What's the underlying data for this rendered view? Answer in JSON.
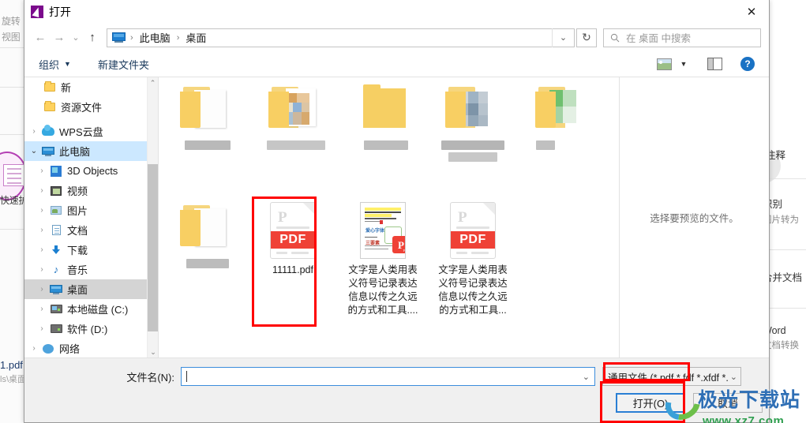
{
  "background_app": {
    "left_labels": [
      "旋转",
      "视图"
    ],
    "left_bottom_file": "1.pdf",
    "left_bottom_path": "ls\\桌面",
    "left_tool_label": "快速护",
    "right_items": [
      {
        "title": "注释",
        "sub": ""
      },
      {
        "title": "识别",
        "sub": "图片转为"
      },
      {
        "title": "合并文档",
        "sub": ""
      },
      {
        "title": "Word",
        "sub": "文档转换"
      }
    ]
  },
  "dialog": {
    "title": "打开",
    "title_icon": "pdf-app-icon",
    "close_label": "✕"
  },
  "address_bar": {
    "back_icon": "back-arrow-icon",
    "forward_icon": "forward-arrow-icon",
    "recent_icon": "chevron-down-icon",
    "up_icon": "up-arrow-icon",
    "root_icon": "this-pc-icon",
    "breadcrumbs": [
      "此电脑",
      "桌面"
    ],
    "separator": "›",
    "dropdown_icon": "chevron-down-icon",
    "refresh_icon": "refresh-icon",
    "refresh_label": "↻"
  },
  "search": {
    "icon": "search-icon",
    "placeholder": "在 桌面 中搜索"
  },
  "toolbar": {
    "organize_label": "组织",
    "organize_caret": "▼",
    "new_folder_label": "新建文件夹",
    "view_icon": "view-mode-icon",
    "view_caret": "▼",
    "preview_pane_icon": "preview-pane-icon",
    "help_icon": "help-icon",
    "help_label": "?"
  },
  "sidebar": {
    "items": [
      {
        "label": "新",
        "icon": "folder-icon",
        "chevron": "",
        "state": "none",
        "indent": 1
      },
      {
        "label": "资源文件",
        "icon": "folder-icon",
        "chevron": "",
        "state": "none",
        "indent": 1
      },
      {
        "label": "WPS云盘",
        "icon": "cloud-icon",
        "chevron": "›",
        "state": "none",
        "indent": 0
      },
      {
        "label": "此电脑",
        "icon": "this-pc-icon",
        "chevron": "⌄",
        "state": "selected-blue",
        "indent": 0
      },
      {
        "label": "3D Objects",
        "icon": "3d-objects-icon",
        "chevron": "›",
        "state": "none",
        "indent": 1
      },
      {
        "label": "视频",
        "icon": "videos-icon",
        "chevron": "›",
        "state": "none",
        "indent": 1
      },
      {
        "label": "图片",
        "icon": "pictures-icon",
        "chevron": "›",
        "state": "none",
        "indent": 1
      },
      {
        "label": "文档",
        "icon": "documents-icon",
        "chevron": "›",
        "state": "none",
        "indent": 1
      },
      {
        "label": "下载",
        "icon": "downloads-icon",
        "chevron": "›",
        "state": "none",
        "indent": 1
      },
      {
        "label": "音乐",
        "icon": "music-icon",
        "chevron": "›",
        "state": "none",
        "indent": 1
      },
      {
        "label": "桌面",
        "icon": "desktop-icon",
        "chevron": "›",
        "state": "selected-grey",
        "indent": 1
      },
      {
        "label": "本地磁盘 (C:)",
        "icon": "drive-icon",
        "chevron": "›",
        "state": "none",
        "indent": 1
      },
      {
        "label": "软件 (D:)",
        "icon": "drive-icon",
        "chevron": "›",
        "state": "none",
        "indent": 1
      },
      {
        "label": "网络",
        "icon": "network-icon",
        "chevron": "›",
        "state": "none",
        "indent": 0
      }
    ],
    "scroll_up": "⌃",
    "scroll_down": "⌄"
  },
  "files": [
    {
      "name": "",
      "type": "folder-blurred",
      "selected": false
    },
    {
      "name": "",
      "type": "folder-blurred",
      "selected": false
    },
    {
      "name": "",
      "type": "folder-blurred",
      "selected": false
    },
    {
      "name": "",
      "type": "folder-blurred",
      "selected": false
    },
    {
      "name": "",
      "type": "folder-blurred",
      "selected": false
    },
    {
      "name": "",
      "type": "folder-blurred",
      "selected": false
    },
    {
      "name": "11111.pdf",
      "type": "pdf",
      "selected": true
    },
    {
      "name": "文字是人类用表义符号记录表达信息以传之久远的方式和工具....",
      "type": "document",
      "selected": false
    },
    {
      "name": "文字是人类用表义符号记录表达信息以传之久远的方式和工具...",
      "type": "pdf",
      "selected": false
    }
  ],
  "preview": {
    "text": "选择要预览的文件。"
  },
  "footer": {
    "filename_label": "文件名(N):",
    "filename_value": "",
    "filename_dropdown_icon": "chevron-down-icon",
    "filter_value": "通用文件 (*.pdf *.fdf *.xfdf *.x",
    "filter_caret": "⌄",
    "open_button": "打开(O)",
    "cancel_button": "取消"
  },
  "watermark": {
    "line1": "极光下载站",
    "line2": "www.xz7.com"
  },
  "colors": {
    "accent_blue": "#2a7fd4",
    "selection_blue": "#cce8ff",
    "selection_grey": "#d4d4d4",
    "highlight_red": "#ff0000",
    "pdf_red": "#ef4136",
    "title_purple": "#7b0a8c"
  }
}
